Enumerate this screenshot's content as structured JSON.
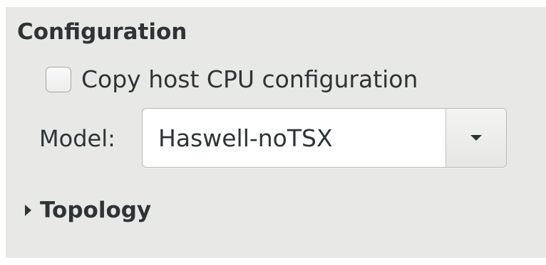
{
  "section": {
    "title": "Configuration"
  },
  "copy_host": {
    "label": "Copy host CPU configuration",
    "checked": false
  },
  "model": {
    "label": "Model:",
    "value": "Haswell-noTSX"
  },
  "topology": {
    "label": "Topology",
    "expanded": false
  }
}
